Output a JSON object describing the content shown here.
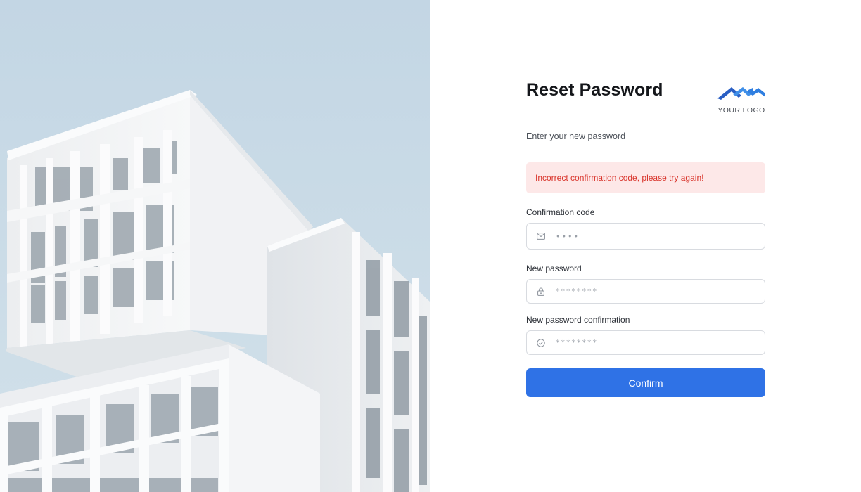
{
  "form": {
    "title": "Reset Password",
    "subtitle": "Enter your new password",
    "logo_text": "YOUR LOGO",
    "error_message": "Incorrect confirmation code, please try again!",
    "fields": [
      {
        "label": "Confirmation code",
        "value": "••••",
        "icon": "mail-icon"
      },
      {
        "label": "New password",
        "placeholder": "********",
        "icon": "lock-icon"
      },
      {
        "label": "New password confirmation",
        "placeholder": "********",
        "icon": "check-circle-icon"
      }
    ],
    "submit_label": "Confirm"
  },
  "colors": {
    "primary": "#2f72e6",
    "error_bg": "#fde8e8",
    "error_text": "#d9342b",
    "sky": "#c9dbe7"
  }
}
